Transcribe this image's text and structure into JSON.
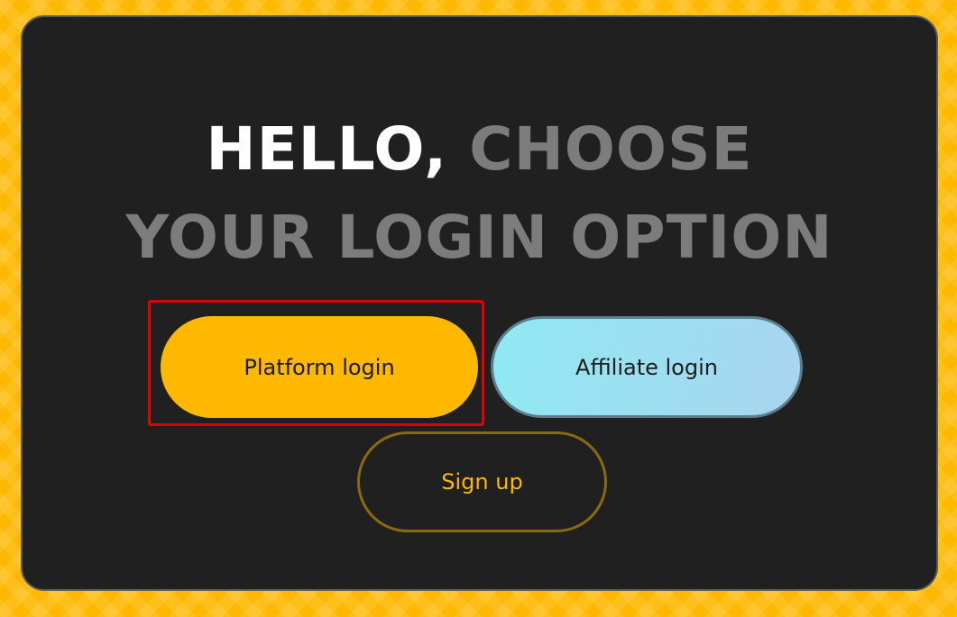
{
  "title": {
    "line1_white": "HELLO,",
    "line1_grey": " CHOOSE",
    "line2": "YOUR LOGIN OPTION"
  },
  "buttons": {
    "platform_login": "Platform login",
    "affiliate_login": "Affiliate login",
    "sign_up": "Sign up"
  },
  "colors": {
    "background": "#FFB800",
    "card": "#202020",
    "accent": "#FFB800",
    "title_grey": "#7c7c7c",
    "affiliate_gradient": [
      "#8fe9f2",
      "#a9d5f0"
    ],
    "highlight": "#e00000"
  }
}
